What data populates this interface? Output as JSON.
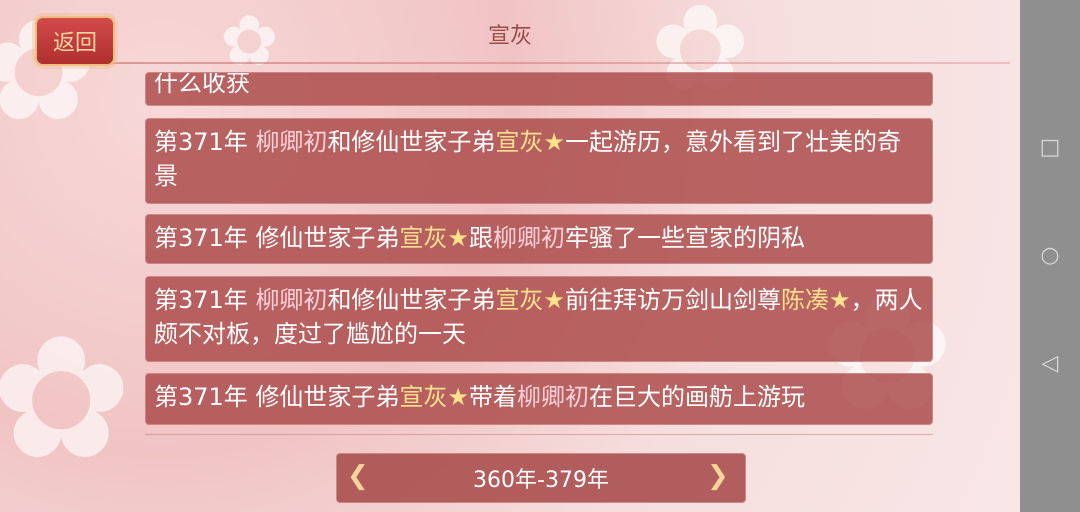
{
  "header": {
    "back_label": "返回",
    "title": "宣灰"
  },
  "entries": [
    {
      "text_parts": [
        "什么收获"
      ]
    },
    {
      "text_parts": [
        {
          "t": "第371年 ",
          "c": "white"
        },
        {
          "t": "柳卿初",
          "c": "pink"
        },
        {
          "t": "和修仙世家子弟",
          "c": "white"
        },
        {
          "t": "宣灰★",
          "c": "gold"
        },
        {
          "t": "一起游历，意外看到了壮美的奇景",
          "c": "white"
        }
      ]
    },
    {
      "text_parts": [
        {
          "t": "第371年 ",
          "c": "white"
        },
        {
          "t": "修仙世家子弟",
          "c": "white"
        },
        {
          "t": "宣灰★",
          "c": "gold"
        },
        {
          "t": "跟",
          "c": "white"
        },
        {
          "t": "柳卿初",
          "c": "pink"
        },
        {
          "t": "牢骚了一些宣家的阴私",
          "c": "white"
        }
      ]
    },
    {
      "text_parts": [
        {
          "t": "第371年 ",
          "c": "white"
        },
        {
          "t": "柳卿初",
          "c": "pink"
        },
        {
          "t": "和修仙世家子弟",
          "c": "white"
        },
        {
          "t": "宣灰★",
          "c": "gold"
        },
        {
          "t": "前往拜访万剑山剑尊",
          "c": "white"
        },
        {
          "t": "陈凑★",
          "c": "gold"
        },
        {
          "t": "，两人颇不对板，度过了尴尬的一天",
          "c": "white"
        }
      ]
    },
    {
      "text_parts": [
        {
          "t": "第371年 ",
          "c": "white"
        },
        {
          "t": "修仙世家子弟",
          "c": "white"
        },
        {
          "t": "宣灰★",
          "c": "gold"
        },
        {
          "t": "带着",
          "c": "white"
        },
        {
          "t": "柳卿初",
          "c": "pink"
        },
        {
          "t": "在巨大的画舫上游玩",
          "c": "white"
        }
      ]
    }
  ],
  "range": {
    "label": "360年-379年"
  },
  "nav": {
    "square": "□",
    "circle": "○",
    "triangle": "◁"
  }
}
